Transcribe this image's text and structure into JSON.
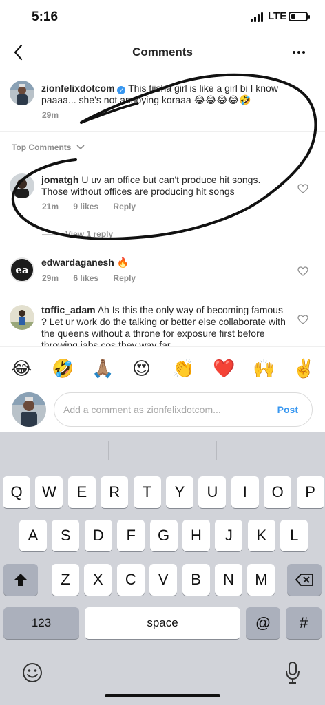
{
  "status_bar": {
    "time": "5:16",
    "network": "LTE",
    "battery_level": 0.3
  },
  "header": {
    "title": "Comments"
  },
  "caption": {
    "username": "zionfelixdotcom",
    "text": " This tiisha girl is like a girl bi I know paaaa... she’s not annoying koraaa 😂😂😂😂🤣",
    "time": "29m"
  },
  "sort": {
    "label": "Top Comments"
  },
  "comments": [
    {
      "username": "jomatgh",
      "text": " U uv an office but can't produce hit songs. Those without offices are producing hit songs",
      "time": "21m",
      "likes": "9 likes",
      "reply": "Reply",
      "view_replies": "View 1 reply"
    },
    {
      "username": "edwardaganesh",
      "text": " 🔥",
      "time": "29m",
      "likes": "6 likes",
      "reply": "Reply",
      "avatar_text": "ea"
    },
    {
      "username": "toffic_adam",
      "text": " Ah Is this the only way of becoming famous ? Let ur work do the talking or better else collaborate with the queens without a throne for exposure first before throwing jabs cos they way far"
    }
  ],
  "emojis": [
    "😂",
    "🤣",
    "🙏🏽",
    "😍",
    "👏",
    "❤️",
    "🙌",
    "✌️"
  ],
  "input": {
    "placeholder": "Add a comment as zionfelixdotcom...",
    "post_label": "Post"
  },
  "keyboard": {
    "row1": [
      "Q",
      "W",
      "E",
      "R",
      "T",
      "Y",
      "U",
      "I",
      "O",
      "P"
    ],
    "row2": [
      "A",
      "S",
      "D",
      "F",
      "G",
      "H",
      "J",
      "K",
      "L"
    ],
    "row3": [
      "Z",
      "X",
      "C",
      "V",
      "B",
      "N",
      "M"
    ],
    "numbers_label": "123",
    "space_label": "space",
    "at_label": "@",
    "hash_label": "#"
  }
}
